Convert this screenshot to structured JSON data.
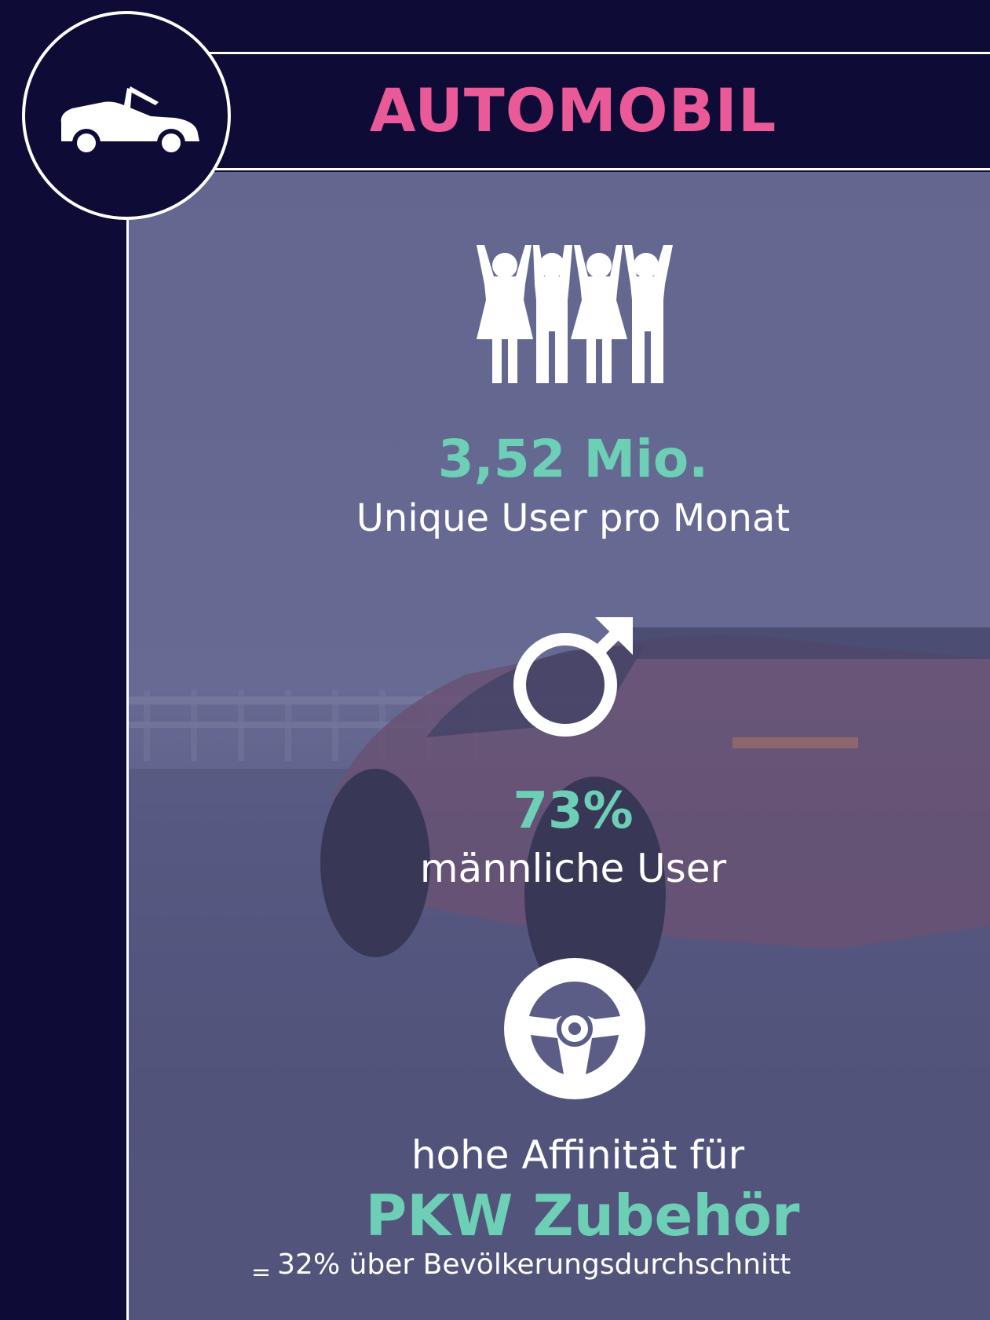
{
  "header": {
    "title": "AUTOMOBIL"
  },
  "icons": {
    "logo": "car-convertible-icon",
    "audience": "people-group-icon",
    "gender": "male-symbol-icon",
    "interest": "steering-wheel-icon"
  },
  "stats": [
    {
      "value": "3,52 Mio.",
      "label": "Unique User pro Monat"
    },
    {
      "value": "73%",
      "label": "männliche User"
    },
    {
      "value": "PKW Zubehör",
      "label": "hohe Affinität für"
    }
  ],
  "footnote": {
    "symbol": "=",
    "text": "32% über Bevölkerungsdurchschnitt"
  },
  "colors": {
    "background": "#0e0c36",
    "accent_pink": "#ea5a98",
    "accent_teal": "#6ccfb6",
    "text": "#ffffff"
  }
}
